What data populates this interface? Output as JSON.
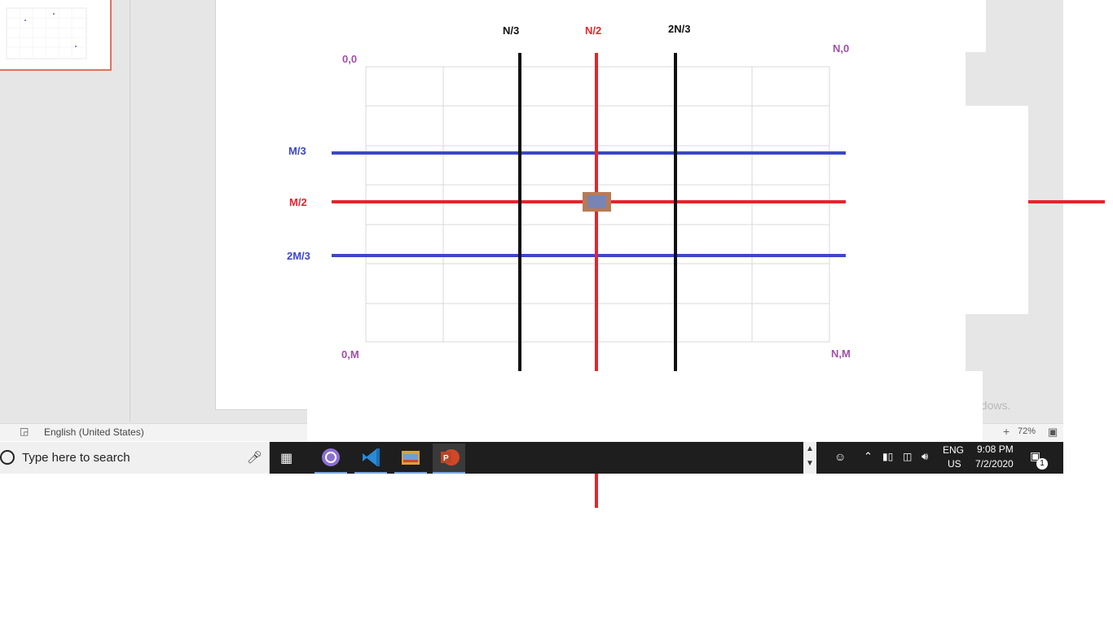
{
  "app": {
    "status_language": "English (United States)",
    "zoom_level": "72%",
    "zoom_plus": "+",
    "watermark_fragment": "ndows."
  },
  "diagram": {
    "top_labels": {
      "n_third": "N/3",
      "n_half": "N/2",
      "two_n_third": "2N/3"
    },
    "side_labels": {
      "m_third": "M/3",
      "m_half": "M/2",
      "two_m_third": "2M/3"
    },
    "corners": {
      "top_left": "0,0",
      "top_right": "N,0",
      "bottom_left": "0,M",
      "bottom_right": "N,M"
    },
    "colors": {
      "red": "#e3262c",
      "blue": "#3c47c8",
      "black": "#111111",
      "purple": "#a14fa8",
      "center_box": "#b77b58",
      "grid": "#d9d9d9"
    },
    "grid": {
      "columns": 6,
      "rows": 7
    }
  },
  "taskbar": {
    "search_placeholder": "Type here to search",
    "apps": [
      {
        "name": "bittorrent-icon",
        "color": "#8b6fd4"
      },
      {
        "name": "vscode-icon",
        "color": "#2a8ad8"
      },
      {
        "name": "file-explorer-icon",
        "color": "#d8a23a"
      },
      {
        "name": "powerpoint-icon",
        "color": "#d24726"
      }
    ],
    "tray": {
      "lang_line1": "ENG",
      "lang_line2": "US",
      "time": "9:08 PM",
      "date": "7/2/2020",
      "notification_count": "1"
    }
  }
}
